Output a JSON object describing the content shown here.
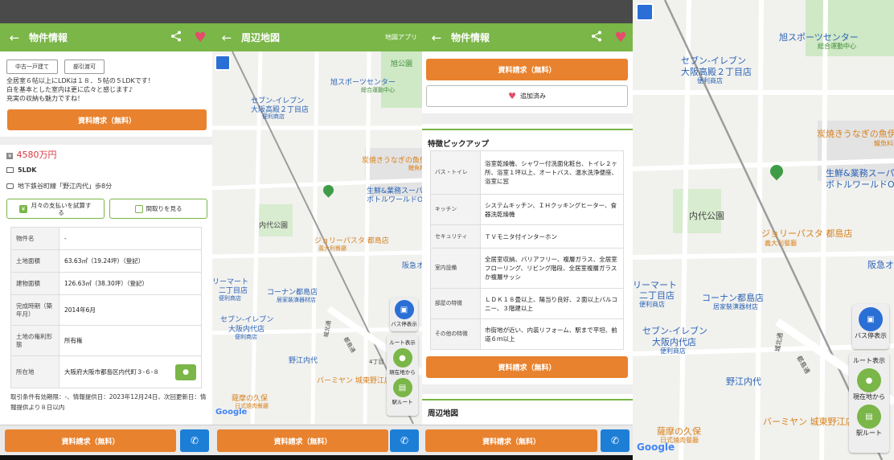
{
  "detail": {
    "title": "物件情報",
    "tags": [
      "中古一戸建て",
      "部引渡可"
    ],
    "description": [
      "全居室６帖以上にLDKは１８．５帖の５LDKです！",
      "白を基本とした室内は更に広々と感じます♪",
      "充実の収納も魅力ですね！"
    ],
    "request_label": "資料請求（無料）",
    "price": "4580万円",
    "yen_icon": "¥",
    "layout": "5LDK",
    "station": "地下鉄谷町線「野江内代」歩8分",
    "payment_button": "月々の支払いを試算する",
    "floorplan_button": "間取りを見る",
    "specs": [
      {
        "key": "物件名",
        "value": "-"
      },
      {
        "key": "土地面積",
        "value": "63.63㎡（19.24坪）（登記）"
      },
      {
        "key": "建物面積",
        "value": "126.63㎡（38.30坪）（登記）"
      },
      {
        "key": "完成時期（築年月）",
        "value": "2014年6月"
      },
      {
        "key": "土地の権利形態",
        "value": "所有権"
      },
      {
        "key": "所在地",
        "value": "大阪府大阪市都島区内代町３-６-８"
      }
    ],
    "note": "取引条件有効期限：-、情報提供日：2023年12月24日、次回更新日：情報提供より８日以内"
  },
  "map_screen": {
    "title": "周辺地図",
    "app_link": "地図アプリ"
  },
  "map_labels": {
    "asahi_park": "旭公園",
    "asahi_sports": "旭スポーツセンター",
    "asahi_sports_sub": "総合運動中心",
    "seven_a": "セブン-イレブン",
    "seven_a2": "大阪高殿２丁目店",
    "seven_a_sub": "便利商店",
    "unagi": "炭焼きうなぎの魚伊",
    "unagi_sub": "鰻魚料理",
    "gyomu": "生鮮&業務スーパー",
    "gyomu2": "ボトルワールドOK",
    "naidai_park": "内代公園",
    "jolly": "ジョリーパスタ 都島店",
    "jolly_sub": "義大利餐廳",
    "hankyu": "阪急オ",
    "mart": "リーマート",
    "mart2": "二丁目店",
    "mart_sub": "便利商店",
    "konan": "コーナン都島店",
    "konan_sub": "居家裝潢器材店",
    "seven_b": "セブン-イレブン",
    "seven_b2": "大阪内代店",
    "seven_b_sub": "便利商店",
    "station_label": "野江内代",
    "toshima": "都島通",
    "joto": "城北通",
    "yonchome": "4丁目",
    "bamiyan": "バーミヤン 城東野江店",
    "satsuma": "薩摩の久保",
    "satsuma_sub": "日式燒肉餐廳",
    "google": "Google",
    "bus_label": "バス停表示",
    "route_label": "ルート表示",
    "current_label": "現在地から",
    "station_route_label": "駅ルート"
  },
  "features": {
    "title": "物件情報",
    "request_label": "資料請求（無料）",
    "added_label": "追加済み",
    "section_title": "特徴ピックアップ",
    "rows": [
      {
        "key": "バス・トイレ",
        "value": "浴室乾燥機、シャワー付洗面化粧台、トイレ２ヶ所、浴室１坪以上、オートバス、温水洗浄便座、浴室に窓"
      },
      {
        "key": "キッチン",
        "value": "システムキッチン、ＩＨクッキングヒーター、食器洗乾燥機"
      },
      {
        "key": "セキュリティ",
        "value": "ＴＶモニタ付インターホン"
      },
      {
        "key": "室内設備",
        "value": "全居室収納、バリアフリー、複層ガラス、全居室フローリング、リビング階段、全居室複層ガラスか複層サッシ"
      },
      {
        "key": "部屋の特徴",
        "value": "ＬＤＫ１８畳以上、陽当り良好、２面以上バルコニー、３階建以上"
      },
      {
        "key": "その他の特徴",
        "value": "市街地が近い、内装リフォーム、駅まで平坦、前道６ｍ以上"
      }
    ],
    "map_section_title": "周辺地図"
  },
  "bottom": {
    "request_label": "資料請求（無料）",
    "call_icon": "phone-icon"
  },
  "colors": {
    "accent_green": "#7ab648",
    "request_orange": "#e8822e",
    "call_blue": "#1d7ed6",
    "price_red": "#d9363e"
  }
}
